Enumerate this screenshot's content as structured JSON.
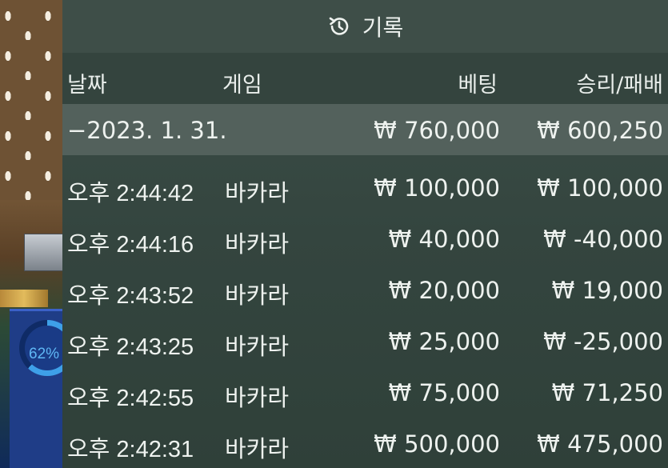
{
  "background": {
    "progress_label": "62%"
  },
  "header": {
    "title": "기록",
    "icon": "history-icon"
  },
  "columns": {
    "date": "날짜",
    "game": "게임",
    "bet": "베팅",
    "result": "승리/패배"
  },
  "summary": {
    "date": "−2023. 1. 31.",
    "bet": "₩ 760,000",
    "result": "₩ 600,250"
  },
  "rows": [
    {
      "time": "오후 2:44:42",
      "game": "바카라",
      "bet": "₩ 100,000",
      "result": "₩ 100,000"
    },
    {
      "time": "오후 2:44:16",
      "game": "바카라",
      "bet": "₩ 40,000",
      "result": "₩ -40,000"
    },
    {
      "time": "오후 2:43:52",
      "game": "바카라",
      "bet": "₩ 20,000",
      "result": "₩ 19,000"
    },
    {
      "time": "오후 2:43:25",
      "game": "바카라",
      "bet": "₩ 25,000",
      "result": "₩ -25,000"
    },
    {
      "time": "오후 2:42:55",
      "game": "바카라",
      "bet": "₩ 75,000",
      "result": "₩ 71,250"
    },
    {
      "time": "오후 2:42:31",
      "game": "바카라",
      "bet": "₩ 500,000",
      "result": "₩ 475,000"
    }
  ]
}
